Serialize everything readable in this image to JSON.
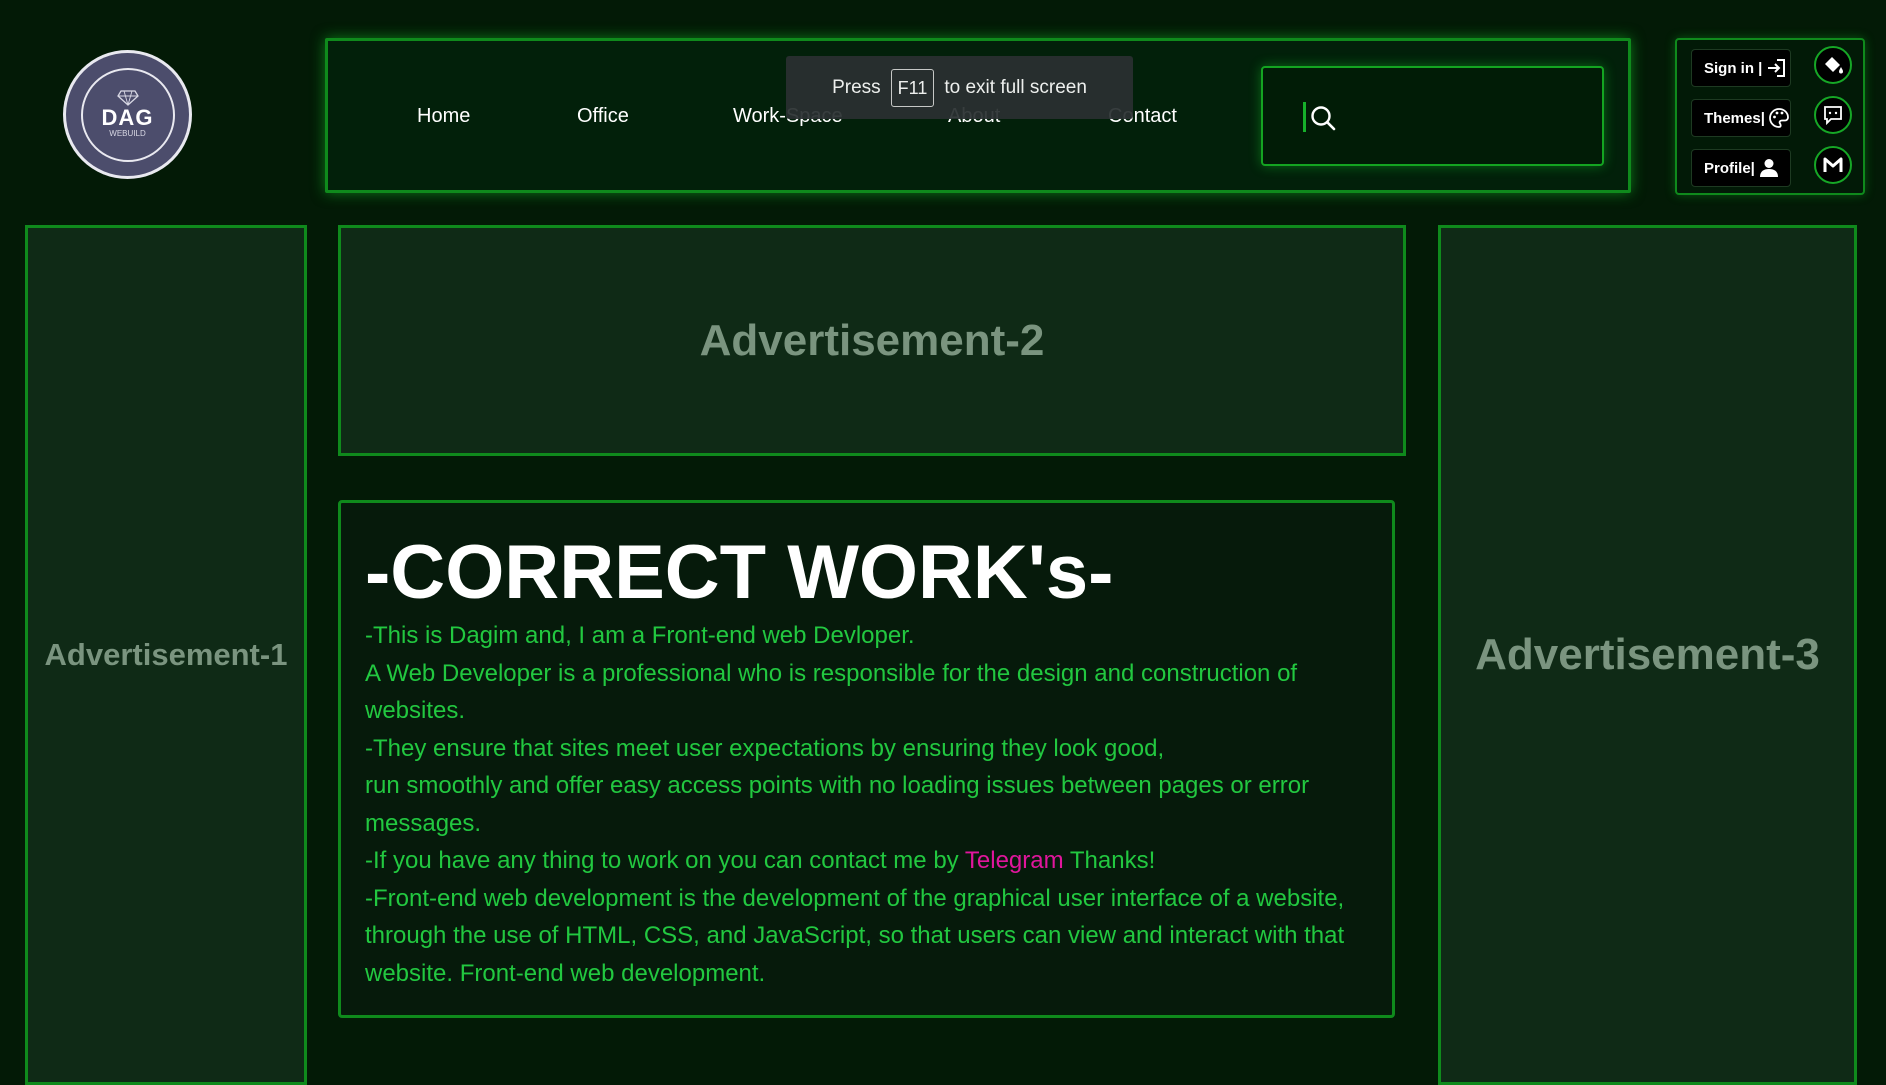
{
  "logo": {
    "title": "DAG",
    "subtitle": "WEBUILD",
    "icon": "diamond-icon"
  },
  "nav": {
    "links": [
      {
        "label": "Home"
      },
      {
        "label": "Office"
      },
      {
        "label": "Work-Space"
      },
      {
        "label": "About"
      },
      {
        "label": "Contact"
      }
    ],
    "search": {
      "placeholder": "",
      "icon": "search-icon"
    }
  },
  "toast": {
    "press": "Press",
    "key": "F11",
    "rest": "to exit full screen"
  },
  "account": {
    "sign_in": "Sign in |",
    "themes": "Themes|",
    "profile": "Profile|",
    "icons": [
      "sign-in-icon",
      "palette-icon",
      "user-icon",
      "paint-bucket-icon",
      "chat-icon",
      "gmail-icon"
    ]
  },
  "ads": {
    "ad1": "Advertisement-1",
    "ad2": "Advertisement-2",
    "ad3": "Advertisement-3"
  },
  "content": {
    "title": "-CORRECT WORK's-",
    "p1": "-This is Dagim and, I am a Front-end web Devloper.",
    "p2": "A Web Developer is a professional who is responsible for the design and construction of websites.",
    "p3": "-They ensure that sites meet user expectations by ensuring they look good,",
    "p4": "run smoothly and offer easy access points with no loading issues between pages or error messages.",
    "p5_before": "-If you have any thing to work on you can contact me by ",
    "p5_link": "Telegram",
    "p5_after": " Thanks!",
    "p6": "-Front-end web development is the development of the graphical user interface of a website, through the use of HTML, CSS, and JavaScript, so that users can view and interact with that website. Front-end web development."
  },
  "colors": {
    "background": "#031a06",
    "border_green": "#0f8a1c",
    "text_green": "#22c840",
    "link_pink": "#e0169c",
    "ad_text": "#7a947f"
  }
}
